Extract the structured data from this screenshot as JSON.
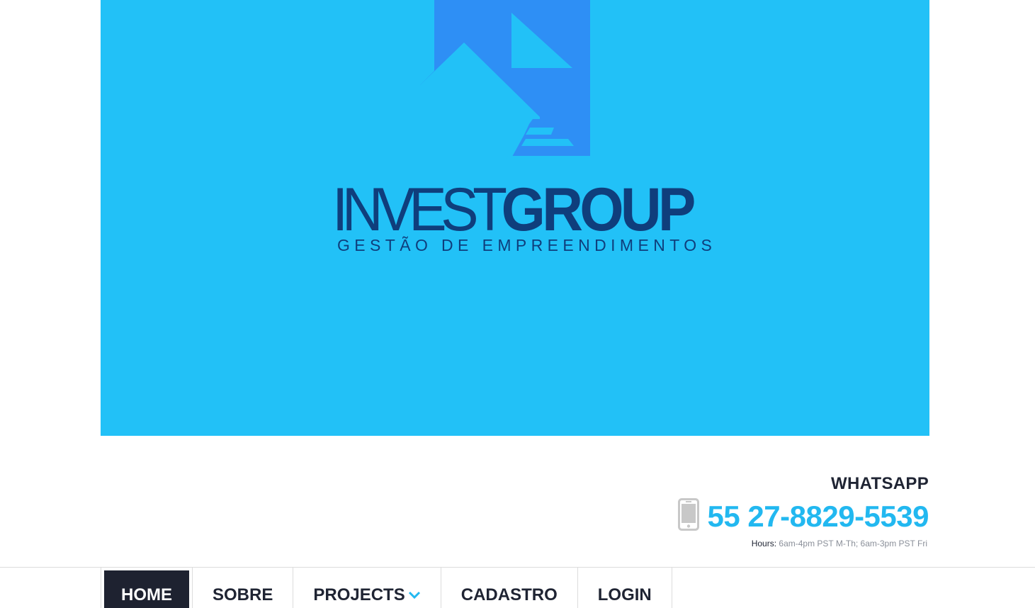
{
  "banner": {
    "background_color": "#22c1f7",
    "logo_mark_color": "#2e8ff5",
    "brand_color": "#0f3e7c",
    "logo": {
      "word_light": "INVEST",
      "word_bold": "GROUP",
      "tagline": "GESTÃO DE EMPREENDIMENTOS"
    }
  },
  "contact": {
    "label": "WHATSAPP",
    "phone_icon": "mobile-phone-icon",
    "phone": "55 27-8829-5539",
    "hours_key": "Hours:",
    "hours_value": " 6am-4pm PST M-Th;  6am-3pm PST Fri",
    "accent_color": "#22b8f0"
  },
  "nav": {
    "items": [
      {
        "label": "HOME",
        "active": true
      },
      {
        "label": "SOBRE",
        "active": false
      },
      {
        "label": "PROJECTS",
        "active": false,
        "has_dropdown": true,
        "dropdown_icon": "chevron-down-icon"
      },
      {
        "label": "CADASTRO",
        "active": false
      },
      {
        "label": "LOGIN",
        "active": false
      }
    ]
  }
}
